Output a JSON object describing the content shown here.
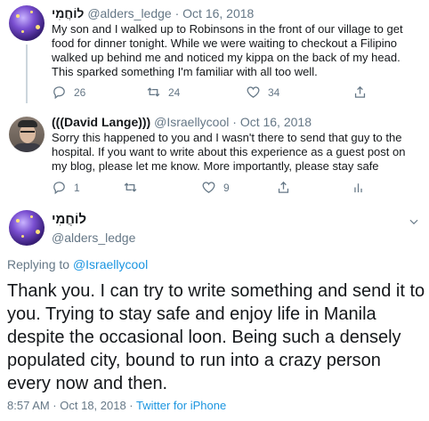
{
  "tweet1": {
    "name": "לוֹחֲמִי",
    "handle": "@alders_ledge",
    "date": "Oct 16, 2018",
    "dot": "·",
    "text": "My son and I walked up to Robinsons in the front of our village to get food for dinner tonight. While we were waiting to checkout a Filipino walked up behind me and noticed my kippa on the back of my head. This sparked something I'm familiar with all too well.",
    "replies": "26",
    "retweets": "24",
    "likes": "34"
  },
  "tweet2": {
    "name": "(((David Lange)))",
    "handle": "@Israellycool",
    "date": "Oct 16, 2018",
    "dot": "·",
    "text": "Sorry this happened to you and I wasn't there to send that guy to the hospital. If you want to write about this experience as a guest post on my blog, please let me know. More importantly, please stay safe",
    "replies": "1",
    "retweets": "",
    "likes": "9"
  },
  "main": {
    "name": "לוֹחֲמִי",
    "handle": "@alders_ledge",
    "replying_prefix": "Replying to ",
    "replying_to": "@Israellycool",
    "text": "Thank you. I can try to write something and send it to you. Trying to stay safe and enjoy life in Manila despite the occasional loon. Being such a densely populated city, bound to run into a crazy person every now and then.",
    "time": "8:57 AM · Oct 18, 2018 · ",
    "source": "Twitter for iPhone"
  },
  "colors": {
    "text": "#14171a",
    "muted": "#657786",
    "link": "#1b95e0",
    "border": "#e6ecf0"
  },
  "icons": [
    "reply-icon",
    "retweet-icon",
    "like-icon",
    "share-icon",
    "analytics-icon",
    "chevron-down-icon"
  ]
}
